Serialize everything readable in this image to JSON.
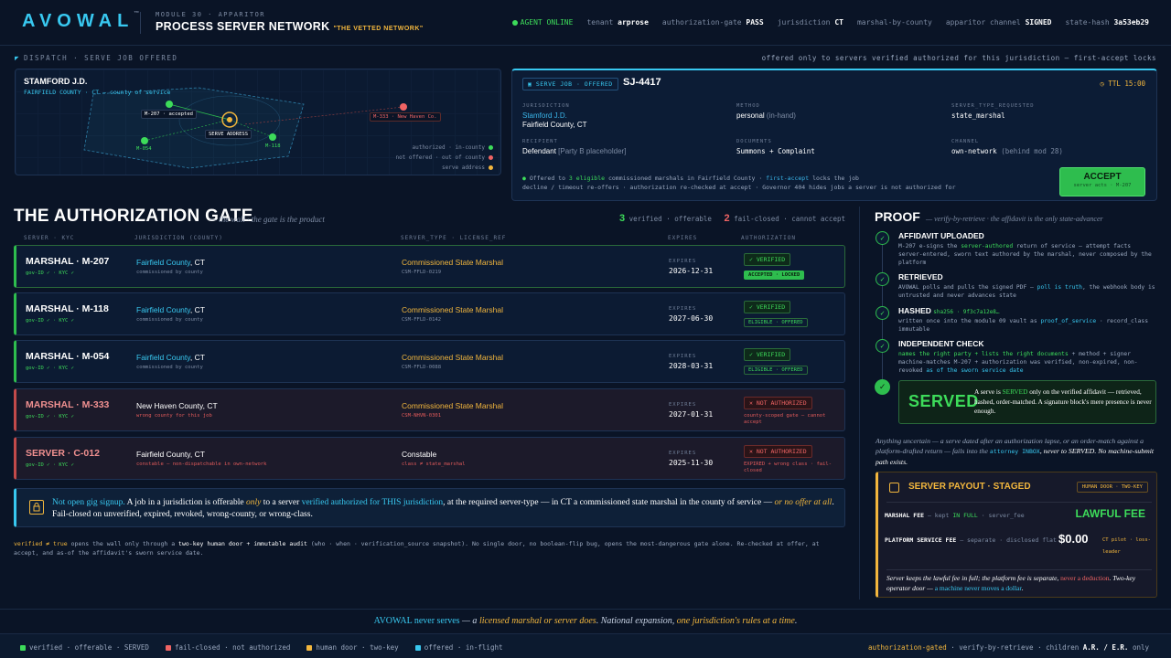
{
  "colors": {
    "accent": "#38c8f0",
    "ok": "#3ddc5a",
    "warn": "#f2b63d",
    "bad": "#f06464",
    "bg": "#0a1426"
  },
  "header": {
    "logo": "AVOWAL",
    "logo_mark": "™",
    "module_label": "MODULE 30 · APPARITOR",
    "title": "PROCESS SERVER NETWORK",
    "tagline": "\"THE VETTED NETWORK\"",
    "status": {
      "agent": "AGENT ONLINE",
      "tenant_k": "tenant",
      "tenant_v": "arprose",
      "gate_k": "authorization-gate",
      "gate_v": "PASS",
      "jur_k": "jurisdiction",
      "jur_v": "CT",
      "marshal": "marshal-by-county",
      "channel_k": "apparitor channel",
      "channel_v": "SIGNED",
      "hash_k": "state-hash",
      "hash_v": "3a53eb29"
    }
  },
  "dispatch": {
    "label": "DISPATCH · SERVE JOB OFFERED",
    "note": "offered only to servers verified authorized for this jurisdiction — first-accept locks"
  },
  "map": {
    "title": "STAMFORD J.D.",
    "subtitle": "FAIRFIELD COUNTY · CT — county of service",
    "tag_m207": "M-207 · accepted",
    "tag_serve": "SERVE ADDRESS",
    "tag_m333": "M-333 · New Haven Co.",
    "label_m054": "M-054",
    "label_m118": "M-118",
    "legend": [
      "authorized · in-county",
      "not offered · out of county",
      "serve address"
    ]
  },
  "job": {
    "badge": "SERVE JOB · OFFERED",
    "id": "SJ-4417",
    "ttl": "TTL 15:00",
    "jurisdiction_k": "JURISDICTION",
    "jurisdiction_v1": "Stamford J.D.",
    "jurisdiction_v2": "Fairfield County, CT",
    "method_k": "METHOD",
    "method_v": "personal",
    "method_sub": "(in-hand)",
    "type_k": "SERVER_TYPE_REQUESTED",
    "type_v": "state_marshal",
    "recipient_k": "RECIPIENT",
    "recipient_v": "Defendant",
    "recipient_sub": "[Party B placeholder]",
    "docs_k": "DOCUMENTS",
    "docs_v": "Summons + Complaint",
    "channel_k": "CHANNEL",
    "channel_v": "own-network",
    "channel_sub": "(behind mod 28)",
    "note_a": "Offered to",
    "note_b": "3 eligible",
    "note_c": "commissioned marshals in Fairfield County ·",
    "note_d": "first-accept",
    "note_e": "locks the job",
    "note2": "decline / timeout re-offers · authorization re-checked at accept · Governor 404 hides jobs a server is not authorized for",
    "accept_label": "ACCEPT",
    "accept_sub": "server acts · M-207"
  },
  "gate": {
    "title": "THE AUTHORIZATION GATE",
    "subtitle": "— the wall · the gate is the product",
    "count_ok": "3",
    "count_ok_label": "verified · offerable",
    "count_bad": "2",
    "count_bad_label": "fail-closed · cannot accept",
    "headers": [
      "SERVER · KYC",
      "JURISDICTION (COUNTY)",
      "SERVER_TYPE · LICENSE_REF",
      "EXPIRES",
      "AUTHORIZATION"
    ],
    "expires_k": "EXPIRES",
    "rows": [
      {
        "name": "MARSHAL · M-207",
        "kyc": "gov-ID ✓ · KYC ✓",
        "county": "Fairfield County",
        "state": ", CT",
        "jsub": "commissioned by county",
        "type": "Commissioned State Marshal",
        "lic": "CSM-FFLD-0219",
        "exp": "2026-12-31",
        "badge": "✓ VERIFIED",
        "badge2": "ACCEPTED · LOCKED"
      },
      {
        "name": "MARSHAL · M-118",
        "kyc": "gov-ID ✓ · KYC ✓",
        "county": "Fairfield County",
        "state": ", CT",
        "jsub": "commissioned by county",
        "type": "Commissioned State Marshal",
        "lic": "CSM-FFLD-0142",
        "exp": "2027-06-30",
        "badge": "✓ VERIFIED",
        "badge2": "ELIGIBLE · OFFERED"
      },
      {
        "name": "MARSHAL · M-054",
        "kyc": "gov-ID ✓ · KYC ✓",
        "county": "Fairfield County",
        "state": ", CT",
        "jsub": "commissioned by county",
        "type": "Commissioned State Marshal",
        "lic": "CSM-FFLD-0088",
        "exp": "2028-03-31",
        "badge": "✓ VERIFIED",
        "badge2": "ELIGIBLE · OFFERED"
      },
      {
        "name": "MARSHAL · M-333",
        "kyc": "gov-ID ✓ · KYC ✓",
        "county": "New Haven County, CT",
        "jsub": "wrong county for this job",
        "type": "Commissioned State Marshal",
        "lic": "CSM-NHVN-0301",
        "exp": "2027-01-31",
        "badge": "✕ NOT AUTHORIZED",
        "note": "county-scoped gate — cannot accept"
      },
      {
        "name": "SERVER · C-012",
        "kyc": "gov-ID ✓ · KYC ✓",
        "county": "Fairfield County, CT",
        "jsub": "constable — non-dispatchable in own-network",
        "type": "Constable",
        "lic": "class ≠ state_marshal",
        "exp": "2025-11-30",
        "badge": "✕ NOT AUTHORIZED",
        "note": "EXPIRED + wrong class · fail-closed"
      }
    ],
    "policy_a": "Not open gig signup.",
    "policy_b": "A job in a jurisdiction is offerable",
    "policy_c": "only",
    "policy_d": "to a server",
    "policy_e": "verified authorized for THIS jurisdiction",
    "policy_f": ", at the required server-type — in CT a commissioned state marshal in the county of service —",
    "policy_g": "or no offer at all",
    "policy_h": ". Fail-closed on unverified, expired, revoked, wrong-county, or wrong-class.",
    "foot_a": "verified ≠ true",
    "foot_b": "opens the wall only through a",
    "foot_c": "two-key human door + immutable audit",
    "foot_d": "(who · when · verification_source snapshot). No single door, no boolean-flip bug, opens the most-dangerous gate alone. Re-checked at offer, at accept, and as-of the affidavit's sworn service date."
  },
  "proof": {
    "title": "PROOF",
    "subtitle": "— verify-by-retrieve · the affidavit is the only state-advancer",
    "steps": [
      {
        "title": "AFFIDAVIT UPLOADED"
      },
      {
        "title": "RETRIEVED"
      },
      {
        "title": "HASHED",
        "hash": "sha256 · 9f3c7a12e8…"
      },
      {
        "title": "INDEPENDENT CHECK"
      }
    ],
    "s1_a": "M-207 e-signs the",
    "s1_b": "server-authored",
    "s1_c": "return of service — attempt facts server-entered, sworn text authored by the marshal, never composed by the platform",
    "s2_a": "AVOWAL polls and pulls the signed PDF —",
    "s2_b": "poll is truth",
    "s2_c": ", the webhook body is untrusted and never advances state",
    "s3_a": "written once into the module 09 vault as",
    "s3_b": "proof_of_service",
    "s3_c": "· record_class immutable",
    "s4_a": "names the right party + lists the right documents",
    "s4_b": "+ method + signer machine-matches M-207 + authorization was verified, non-expired, non-revoked",
    "s4_c": "as of the sworn service date",
    "served_word": "SERVED",
    "served_a": "A serve is",
    "served_b": "SERVED",
    "served_c": "only on the verified affidavit — retrieved, hashed, order-matched. A signature block's mere presence is never enough.",
    "italic_a": "Anything uncertain — a serve dated after an authorization lapse, or an order-match against a platform-drafted return — fails into the",
    "italic_b": "attorney INBOX",
    "italic_c": ", never to SERVED. No machine-submit path exists."
  },
  "payout": {
    "title": "SERVER PAYOUT · STAGED",
    "badge": "HUMAN DOOR · TWO-KEY",
    "fee_k": "MARSHAL FEE",
    "fee_a": "— kept",
    "fee_b": "IN FULL",
    "fee_c": "· server_fee",
    "fee_v": "LAWFUL FEE",
    "plat_k": "PLATFORM SERVICE FEE",
    "plat_a": "— separate · disclosed",
    "plat_b": "flat",
    "plat_v": "$0.00",
    "plat_note": "CT pilot · loss-leader",
    "foot_a": "Server keeps the lawful fee in full; the platform fee is separate,",
    "foot_b": "never a deduction",
    "foot_c": ". Two-key operator door —",
    "foot_d": "a machine never moves a dollar",
    "foot_e": "."
  },
  "footer": {
    "tag_a": "AVOWAL never serves",
    "tag_b": "— a",
    "tag_c": "licensed marshal or server does",
    "tag_d": ". National expansion,",
    "tag_e": "one jurisdiction's rules at a time",
    "tag_f": ".",
    "legend": [
      "verified · offerable · SERVED",
      "fail-closed · not authorized",
      "human door · two-key",
      "offered · in-flight"
    ],
    "right_a": "authorization-gated",
    "right_b": "· verify-by-retrieve ·",
    "right_c": "children",
    "right_d": "A.R. / E.R.",
    "right_e": "only"
  }
}
